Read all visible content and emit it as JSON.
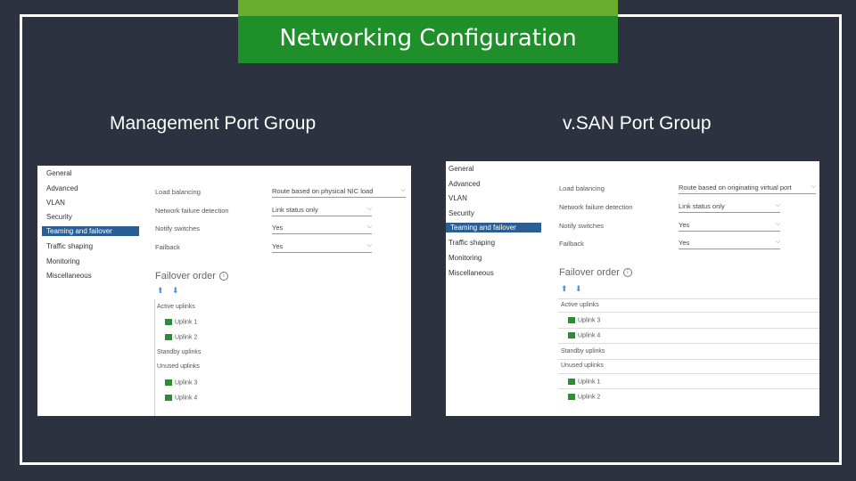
{
  "title": "Networking Configuration",
  "panels": [
    {
      "heading": "Management Port Group",
      "nav": [
        "General",
        "Advanced",
        "VLAN",
        "Security",
        "Teaming and failover",
        "Traffic shaping",
        "Monitoring",
        "Miscellaneous"
      ],
      "active_nav": "Teaming and failover",
      "settings": [
        {
          "label": "Load balancing",
          "value": "Route based on physical NIC load"
        },
        {
          "label": "Network failure detection",
          "value": "Link status only"
        },
        {
          "label": "Notify switches",
          "value": "Yes"
        },
        {
          "label": "Failback",
          "value": "Yes"
        }
      ],
      "failover_title": "Failover order",
      "active_label": "Active uplinks",
      "active_uplinks": [
        "Uplink 1",
        "Uplink 2"
      ],
      "standby_label": "Standby uplinks",
      "standby_uplinks": [],
      "unused_label": "Unused uplinks",
      "unused_uplinks": [
        "Uplink 3",
        "Uplink 4"
      ]
    },
    {
      "heading": "v.SAN Port Group",
      "nav": [
        "General",
        "Advanced",
        "VLAN",
        "Security",
        "Teaming and failover",
        "Traffic shaping",
        "Monitoring",
        "Miscellaneous"
      ],
      "active_nav": "Teaming and failover",
      "settings": [
        {
          "label": "Load balancing",
          "value": "Route based on originating virtual port"
        },
        {
          "label": "Network failure detection",
          "value": "Link status only"
        },
        {
          "label": "Notify switches",
          "value": "Yes"
        },
        {
          "label": "Failback",
          "value": "Yes"
        }
      ],
      "failover_title": "Failover order",
      "active_label": "Active uplinks",
      "active_uplinks": [
        "Uplink 3",
        "Uplink 4"
      ],
      "standby_label": "Standby uplinks",
      "standby_uplinks": [],
      "unused_label": "Unused uplinks",
      "unused_uplinks": [
        "Uplink 1",
        "Uplink 2"
      ]
    }
  ]
}
